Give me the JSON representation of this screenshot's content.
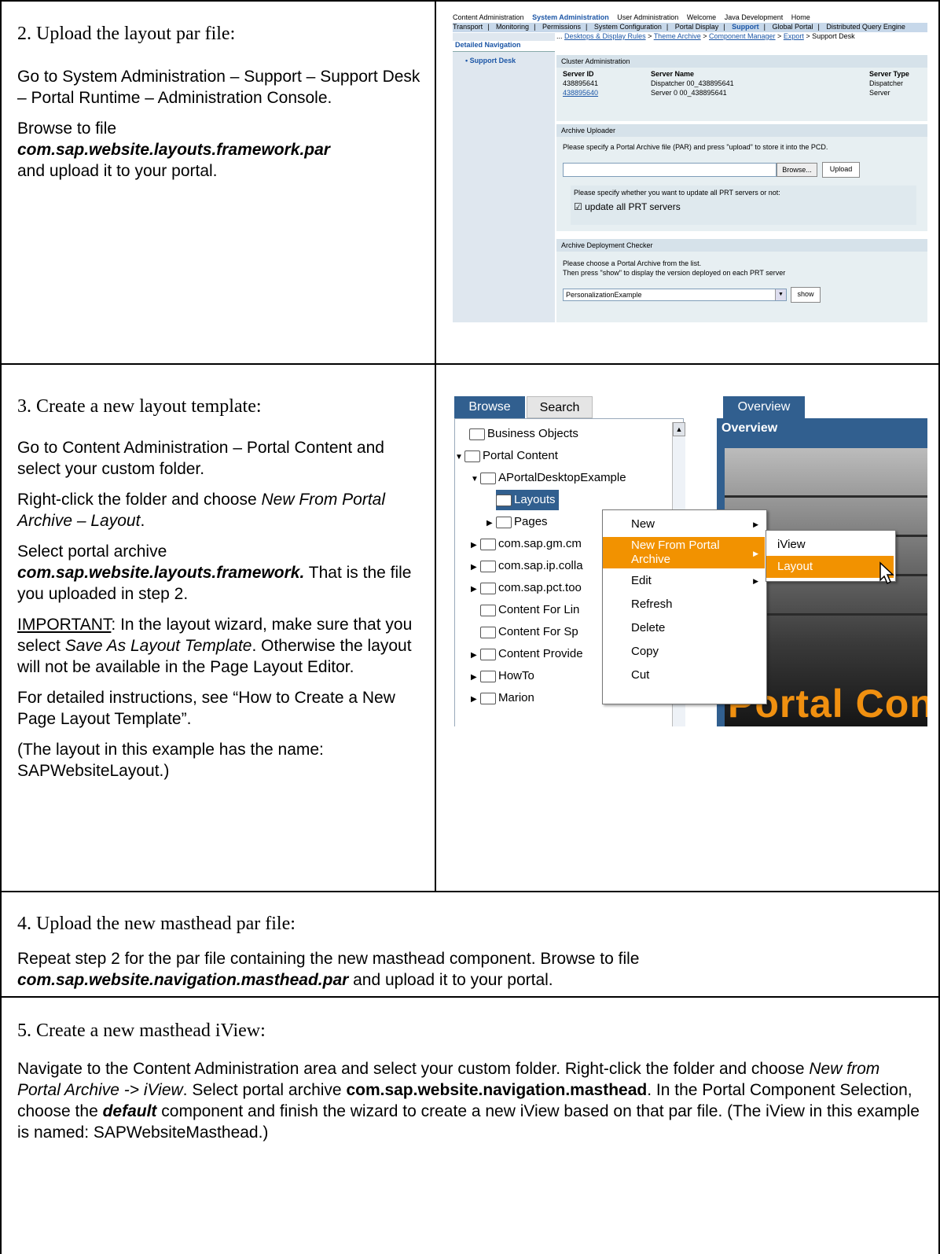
{
  "step2": {
    "title": "2.  Upload the layout par file:",
    "p1": "Go to System Administration – Support – Support Desk – Portal Runtime – Administration Console.",
    "p2_prefix": "Browse to file",
    "p2_file": "com.sap.website.layouts.framework.par",
    "p2_suffix": "and upload it to your portal."
  },
  "shot1": {
    "topnav": [
      "Content Administration",
      "System Administration",
      "User Administration",
      "Welcome",
      "Java Development",
      "Home"
    ],
    "topnav_selected": "System Administration",
    "subnav": [
      "Transport",
      "|",
      "Monitoring",
      "|",
      "Permissions",
      "|",
      "System Configuration",
      "|",
      "Portal Display",
      "|",
      "Support",
      "|",
      "Global Portal",
      "|",
      "Distributed Query Engine"
    ],
    "subnav_selected": "Support",
    "detailed_navigation": "Detailed Navigation",
    "support_desk": "• Support Desk",
    "breadcrumb_prefix": "...",
    "breadcrumb": [
      "Desktops & Display Rules",
      "Theme Archive",
      "Component Manager",
      "Export"
    ],
    "breadcrumb_current": "Support Desk",
    "cluster_title": "Cluster Administration",
    "cluster_headers": [
      "Server ID",
      "Server Name",
      "Server Type"
    ],
    "cluster_rows": [
      [
        "438895641",
        "Dispatcher 00_438895641",
        "Dispatcher"
      ],
      [
        "438895640",
        "Server 0 00_438895641",
        "Server"
      ]
    ],
    "uploader_title": "Archive Uploader",
    "uploader_text": "Please specify a Portal Archive file (PAR) and press \"upload\" to store it into the PCD.",
    "browse_label": "Browse...",
    "upload_label": "Upload",
    "prt_text": "Please specify whether you want to update all PRT servers or not:",
    "checkbox_label": "update all PRT servers",
    "checker_title": "Archive Deployment Checker",
    "checker_text1": "Please choose a Portal Archive from the list.",
    "checker_text2": "Then press \"show\" to display the version deployed on each PRT server",
    "select_value": "PersonalizationExample",
    "show_label": "show"
  },
  "step3": {
    "title": "3.  Create a new layout template:",
    "p1": "Go to Content Administration – Portal Content and select your custom folder.",
    "p2_prefix": "Right-click the folder and choose ",
    "p2_italic": "New From Portal Archive – Layout",
    "p2_suffix": ".",
    "p3_prefix": "Select portal archive",
    "p3_file": "com.sap.website.layouts.framework.",
    "p3_suffix": " That is the file you uploaded in step 2.",
    "p4_important": "IMPORTANT",
    "p4_a": ": In the layout wizard, make sure that you select ",
    "p4_italic": "Save As Layout Template",
    "p4_b": ". Otherwise the layout will not be available in the Page Layout Editor.",
    "p5": "For detailed instructions, see “How to Create a New Page Layout Template”.",
    "p6": "(The layout in this example has the name: SAPWebsiteLayout.)"
  },
  "shot2": {
    "tab_browse": "Browse",
    "tab_search": "Search",
    "tab_overview": "Overview",
    "overview_title": "Overview",
    "tree": [
      {
        "label": "Business Objects",
        "indent": 0,
        "arrow": ""
      },
      {
        "label": "Portal Content",
        "indent": 0,
        "arrow": "▼"
      },
      {
        "label": "APortalDesktopExample",
        "indent": 1,
        "arrow": "▼"
      },
      {
        "label": "Layouts",
        "indent": 2,
        "arrow": ""
      },
      {
        "label": "Pages",
        "indent": 2,
        "arrow": "▶"
      },
      {
        "label": "com.sap.gm.cm",
        "indent": 1,
        "arrow": "▶"
      },
      {
        "label": "com.sap.ip.colla",
        "indent": 1,
        "arrow": "▶"
      },
      {
        "label": "com.sap.pct.too",
        "indent": 1,
        "arrow": "▶"
      },
      {
        "label": "Content For Lin",
        "indent": 1,
        "arrow": ""
      },
      {
        "label": "Content For Sp",
        "indent": 1,
        "arrow": ""
      },
      {
        "label": "Content Provide",
        "indent": 1,
        "arrow": "▶"
      },
      {
        "label": "HowTo",
        "indent": 1,
        "arrow": "▶"
      },
      {
        "label": "Marion",
        "indent": 1,
        "arrow": "▶"
      }
    ],
    "context_menu": [
      "New",
      "New From Portal Archive",
      "Edit",
      "Refresh",
      "Delete",
      "Copy",
      "Cut"
    ],
    "submenu": [
      "iView",
      "Layout"
    ],
    "banner_text": "Portal Con"
  },
  "step4": {
    "title": "4.  Upload the new masthead par file:",
    "text_a": "Repeat step 2 for the par file containing the new masthead component. Browse to file ",
    "file": "com.sap.website.navigation.masthead.par",
    "text_b": " and upload it to your portal."
  },
  "step5": {
    "title": "5.  Create a new masthead iView:",
    "a": "Navigate to the Content Administration area and select your custom folder. Right-click the folder and choose ",
    "i1": "New from Portal Archive -> iView",
    "b": ". Select portal archive ",
    "file": "com.sap.website.navigation.masthead",
    "c": ". In the Portal Component Selection, choose the ",
    "i2": "default",
    "d": " component and finish the wizard to create a new iView based on that par file. (The iView in this example is named: SAPWebsiteMasthead.)"
  },
  "colors": {
    "accent_blue": "#315f8f",
    "menu_highlight": "#f29200",
    "banner_orange": "#f09010"
  }
}
